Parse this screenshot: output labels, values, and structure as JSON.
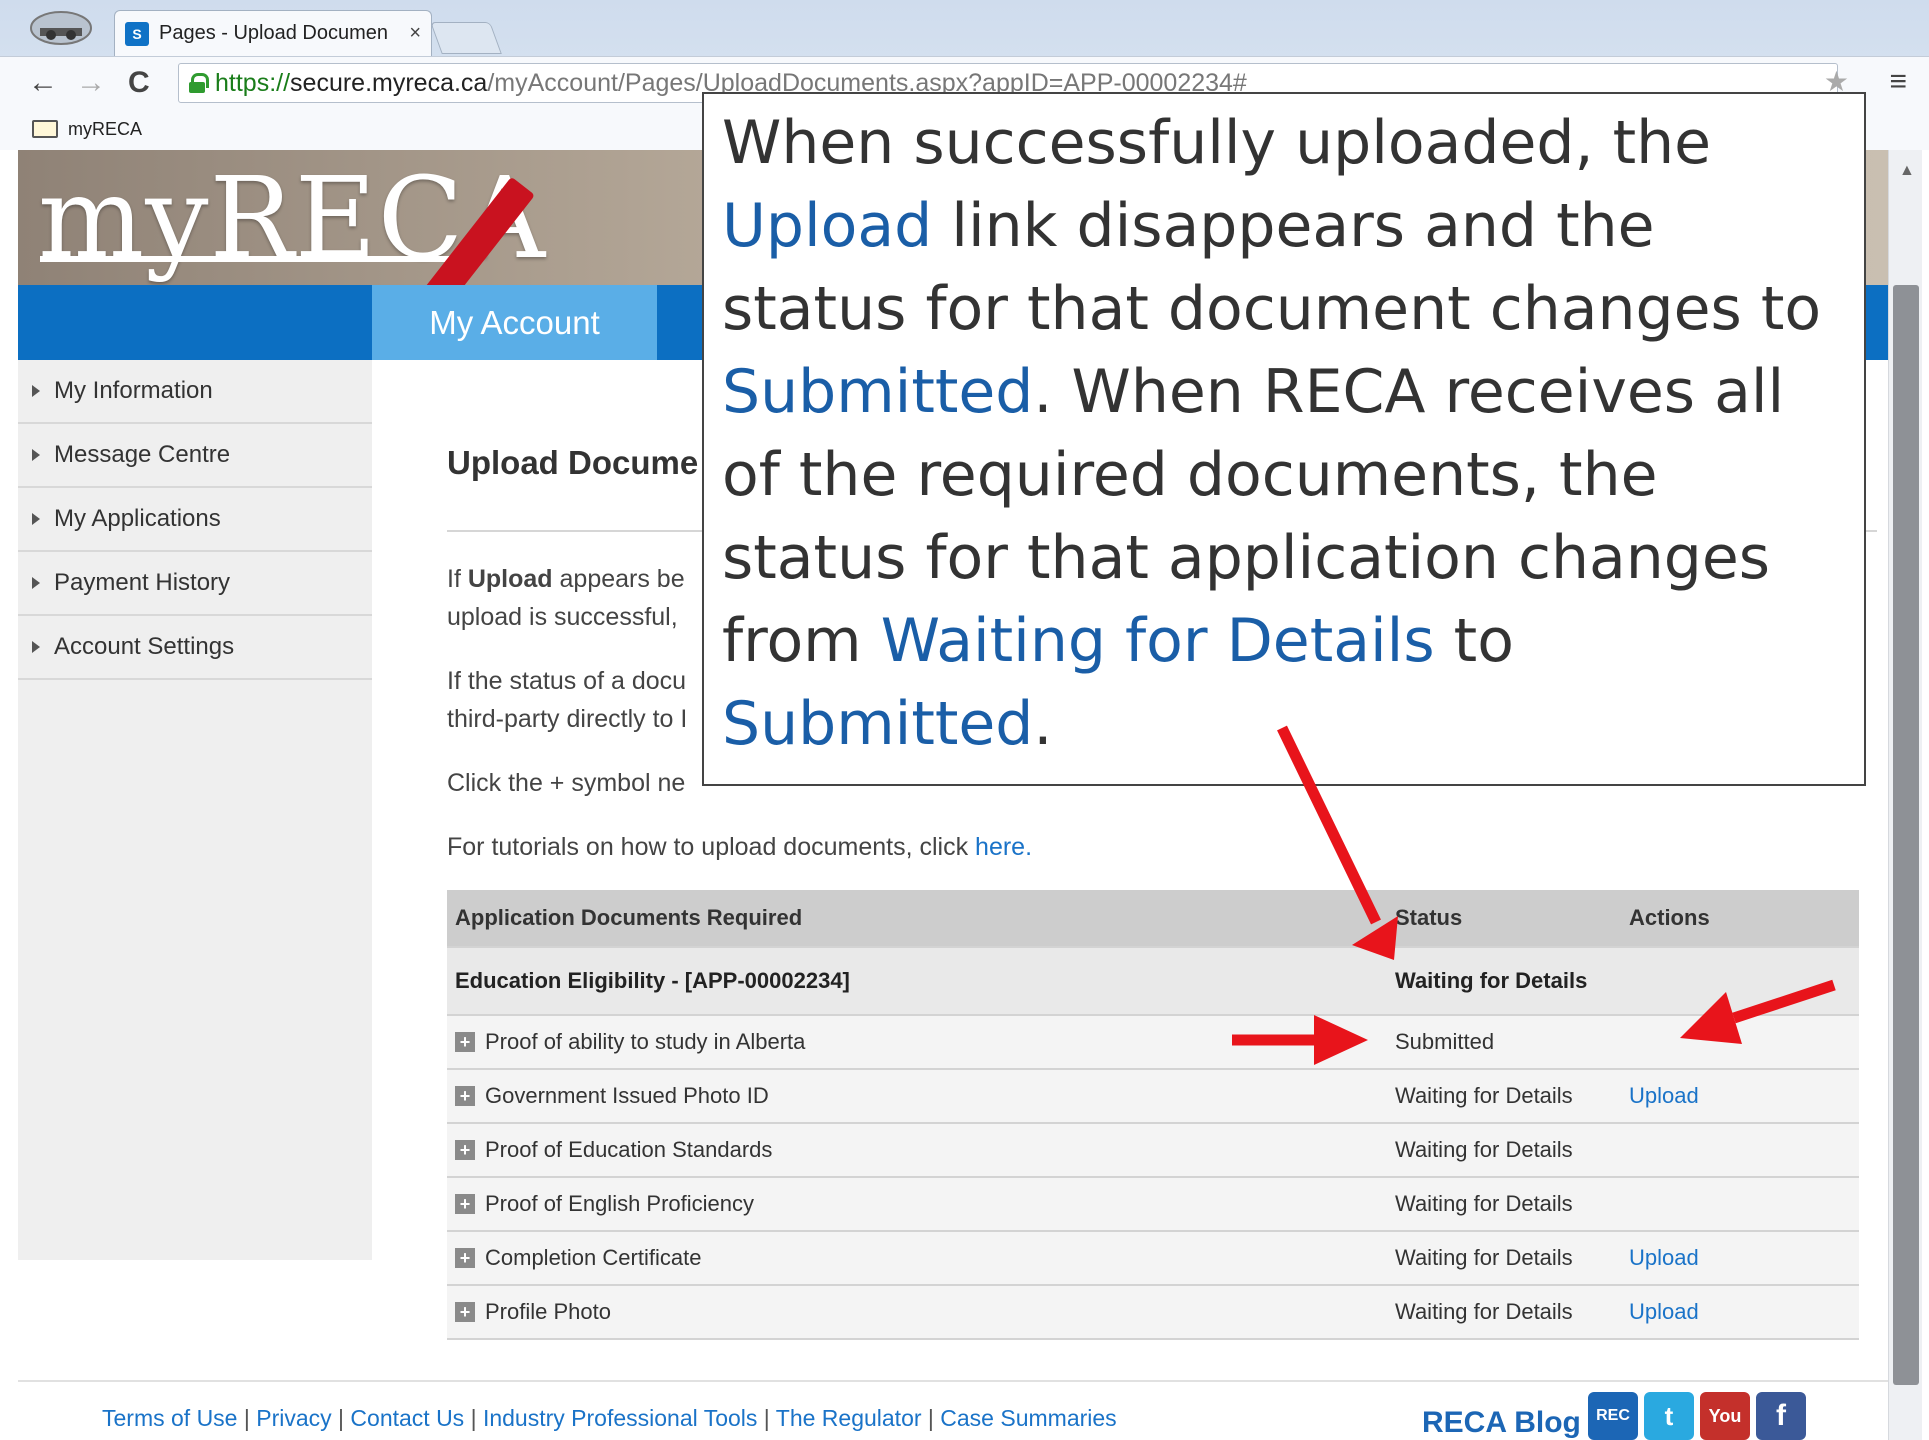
{
  "browser": {
    "tab_title": "Pages - Upload Documen",
    "tab_close": "×",
    "favicon_text": "S",
    "url_protocol": "https://",
    "url_host": "secure.myreca.ca",
    "url_path": "/myAccount/Pages/UploadDocuments.aspx?appID=APP-00002234#",
    "bookmark": "myRECA",
    "icons": {
      "back": "←",
      "forward": "→",
      "reload": "C",
      "star": "★",
      "menu": "≡",
      "scroll_up": "▲"
    }
  },
  "site": {
    "logo": "myRECA",
    "nav_active": "My Account",
    "sidebar": [
      {
        "label": "My Information"
      },
      {
        "label": "Message Centre"
      },
      {
        "label": "My Applications"
      },
      {
        "label": "Payment History"
      },
      {
        "label": "Account Settings"
      }
    ]
  },
  "main": {
    "title": "Upload Docume",
    "para1_a": "If ",
    "para1_b": "Upload",
    "para1_c": " appears be",
    "para1_line2": "upload is successful,",
    "para2_line1": "If the status of a docu",
    "para2_line2": "third-party directly to I",
    "para3": "Click the + symbol ne",
    "para4_text": "For tutorials on how to upload documents, click ",
    "para4_link": "here."
  },
  "table": {
    "headers": {
      "docs": "Application Documents Required",
      "status": "Status",
      "actions": "Actions"
    },
    "group": {
      "name": "Education Eligibility - [APP-00002234]",
      "status": "Waiting for Details"
    },
    "rows": [
      {
        "name": "Proof of ability to study in Alberta",
        "status": "Submitted",
        "action": ""
      },
      {
        "name": "Government Issued Photo ID",
        "status": "Waiting for Details",
        "action": "Upload"
      },
      {
        "name": "Proof of Education Standards",
        "status": "Waiting for Details",
        "action": ""
      },
      {
        "name": "Proof of English Proficiency",
        "status": "Waiting for Details",
        "action": ""
      },
      {
        "name": "Completion Certificate",
        "status": "Waiting for Details",
        "action": "Upload"
      },
      {
        "name": "Profile Photo",
        "status": "Waiting for Details",
        "action": "Upload"
      }
    ],
    "plus": "+"
  },
  "footer": {
    "links": [
      "Terms of Use",
      "Privacy",
      "Contact Us",
      "Industry Professional Tools",
      "The Regulator",
      "Case Summaries"
    ],
    "separator": "|",
    "blog": "RECA Blog",
    "social": [
      "REC",
      "t",
      "You",
      "f"
    ]
  },
  "callout": {
    "t1": "When successfully uploaded, the ",
    "h1": "Upload",
    "t2": " link disappears and the status for that document changes to ",
    "h2": "Submitted",
    "t3": ". When RECA receives all of the required documents, the status for that application changes from ",
    "h3": "Waiting for Details",
    "t4": " to ",
    "h4": "Submitted",
    "t5": "."
  },
  "colors": {
    "arrow": "#e8141b",
    "brand_blue": "#0c6fc2",
    "link": "#1a73c8"
  }
}
